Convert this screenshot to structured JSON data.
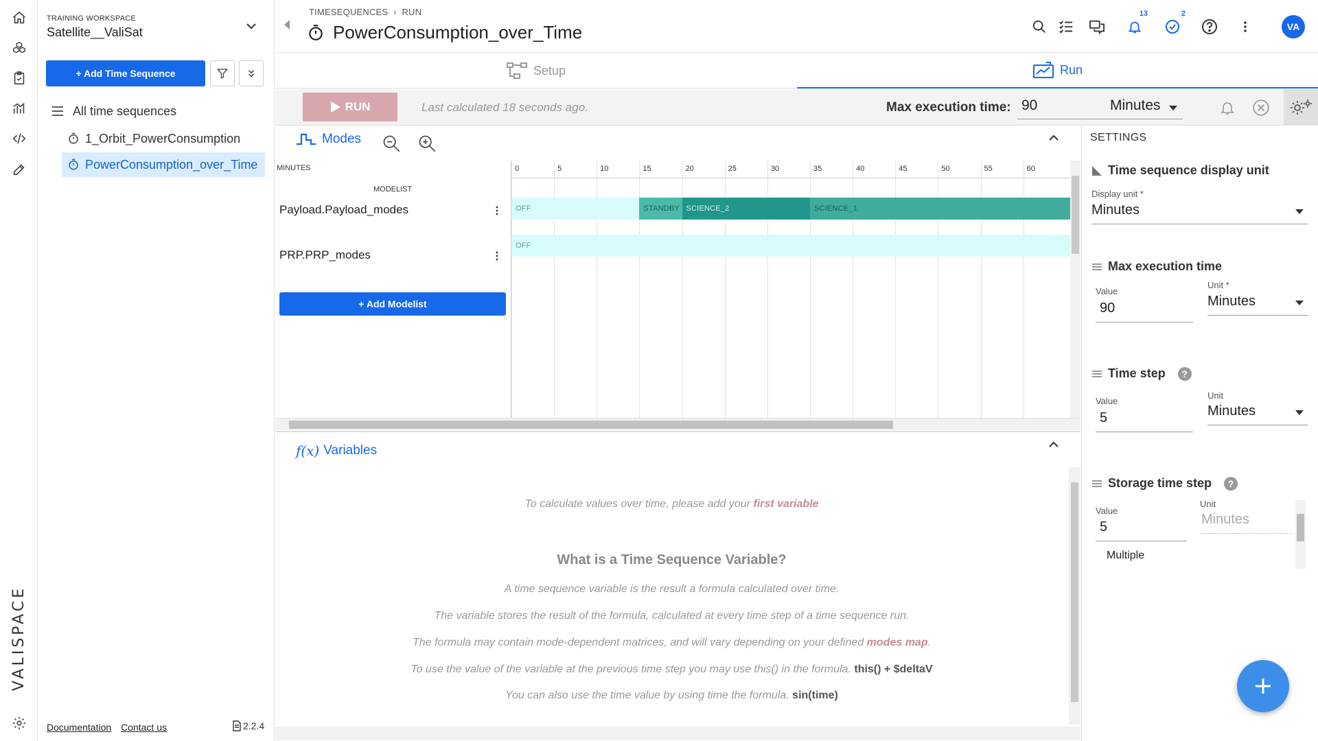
{
  "workspace": {
    "label": "TRAINING WORKSPACE",
    "name": "Satellite__ValiSat"
  },
  "sidebar": {
    "add_button": "+ Add Time Sequence",
    "tree": {
      "all_label": "All time sequences",
      "items": [
        {
          "label": "1_Orbit_PowerConsumption"
        },
        {
          "label": "PowerConsumption_over_Time"
        }
      ]
    },
    "footer": {
      "documentation": "Documentation",
      "contact": "Contact us",
      "version": "2.2.4"
    }
  },
  "brand": "VALISPACE",
  "header": {
    "breadcrumb": [
      "TIMESEQUENCES",
      "RUN"
    ],
    "title": "PowerConsumption_over_Time",
    "notifications_count": "13",
    "tasks_count": "2",
    "avatar_initials": "VA"
  },
  "tabs": {
    "setup": "Setup",
    "run": "Run"
  },
  "runbar": {
    "run_label": "RUN",
    "last_calculated": "Last calculated 18 seconds ago.",
    "max_exec_label": "Max execution time:",
    "max_exec_value": "90",
    "max_exec_unit": "Minutes"
  },
  "modes": {
    "title": "Modes",
    "axis_unit": "MINUTES",
    "modelist_header": "MODELIST",
    "ticks": [
      "0",
      "5",
      "10",
      "15",
      "20",
      "25",
      "30",
      "35",
      "40",
      "45",
      "50",
      "55",
      "60"
    ],
    "add_modelist": "+ Add Modelist",
    "modelists": [
      {
        "name": "Payload.Payload_modes",
        "segments": [
          {
            "label": "OFF",
            "start": 0,
            "end": 15,
            "color": "#d7fbfb",
            "text": "#5a9ea0"
          },
          {
            "label": "STANDBY",
            "start": 15,
            "end": 20,
            "color": "#4bbaa8",
            "text": "#1f5f57"
          },
          {
            "label": "SCIENCE_2",
            "start": 20,
            "end": 35,
            "color": "#21968a",
            "text": "#d9f3ef"
          },
          {
            "label": "SCIENCE_1",
            "start": 35,
            "end": 65.5,
            "color": "#3fac9c",
            "text": "#1f5f57"
          }
        ]
      },
      {
        "name": "PRP.PRP_modes",
        "segments": [
          {
            "label": "OFF",
            "start": 0,
            "end": 65.5,
            "color": "#d7fbfb",
            "text": "#5a9ea0"
          }
        ]
      }
    ]
  },
  "variables": {
    "title": "Variables",
    "fx": "f(x)",
    "intro_pre": "To calculate values over time, please add your ",
    "intro_link": "first variable",
    "question": "What is a Time Sequence Variable?",
    "line1": "A time sequence variable is the result a formula calculated over time.",
    "line2": "The variable stores the result of the formula, calculated at every time step of a time sequence run.",
    "line3_pre": "The formula may contain mode-dependent matrices, and will vary depending on your defined ",
    "line3_link": "modes map",
    "line3_post": ".",
    "line4_pre": "To use the value of the variable at the previous time step you may use this() in the formula. ",
    "line4_code": "this() + $deltaV",
    "line5_pre": "You can also use the time value by using time the formula. ",
    "line5_code": "sin(time)"
  },
  "settings": {
    "title": "SETTINGS",
    "display": {
      "head": "Time sequence display unit",
      "label": "Display unit *",
      "value": "Minutes"
    },
    "max_exec": {
      "head": "Max execution time",
      "value_label": "Value",
      "value": "90",
      "unit_label": "Unit *",
      "unit": "Minutes"
    },
    "time_step": {
      "head": "Time step",
      "value_label": "Value",
      "value": "5",
      "unit_label": "Unit",
      "unit": "Minutes"
    },
    "storage": {
      "head": "Storage time step",
      "value_label": "Value",
      "value": "5",
      "unit_label": "Unit",
      "unit": "Minutes",
      "multiple": "Multiple"
    }
  },
  "colors": {
    "accent": "#1769e8",
    "run_disabled": "#d8a6ad",
    "mode_off": "#d7fbfb",
    "mode_active": "#21968a"
  }
}
